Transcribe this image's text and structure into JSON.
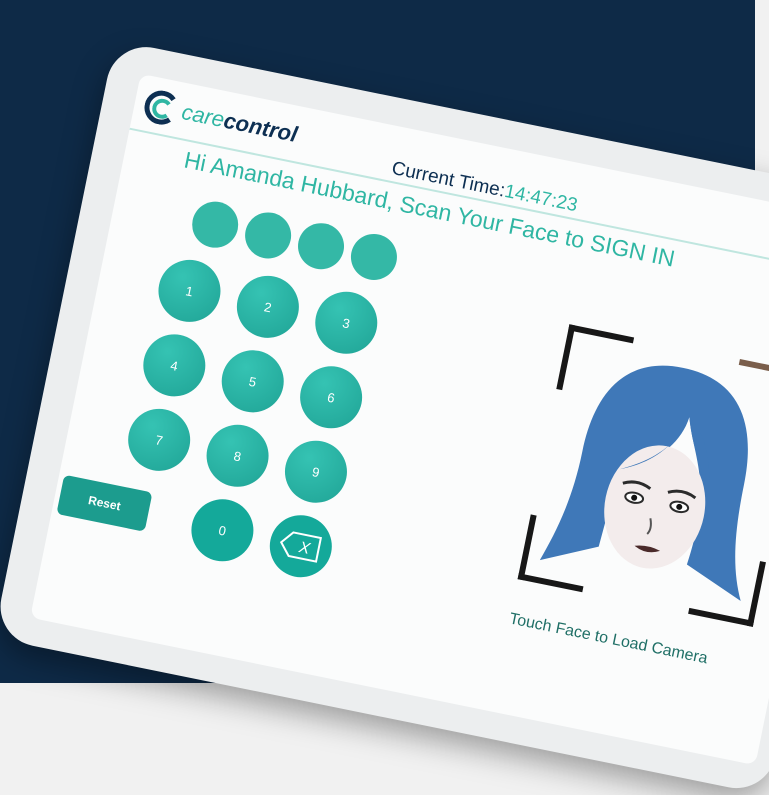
{
  "app": {
    "logo_text_care": "care",
    "logo_text_control": "control"
  },
  "header": {
    "time_label": "Current Time:",
    "time_value": "14:47:23"
  },
  "greeting": "Hi Amanda Hubbard, Scan Your Face to SIGN IN",
  "pin": {
    "digits_entered": 0,
    "max_digits": 4
  },
  "keypad": {
    "keys": [
      "1",
      "2",
      "3",
      "4",
      "5",
      "6",
      "7",
      "8",
      "9",
      "0"
    ],
    "backspace_label": "X"
  },
  "reset_label": "Reset",
  "camera": {
    "prompt": "Touch Face to Load Camera"
  },
  "colors": {
    "background": "#0e2a47",
    "accent": "#2fb6a3",
    "brand_dark": "#0d2f52",
    "key": "#1fa395"
  }
}
